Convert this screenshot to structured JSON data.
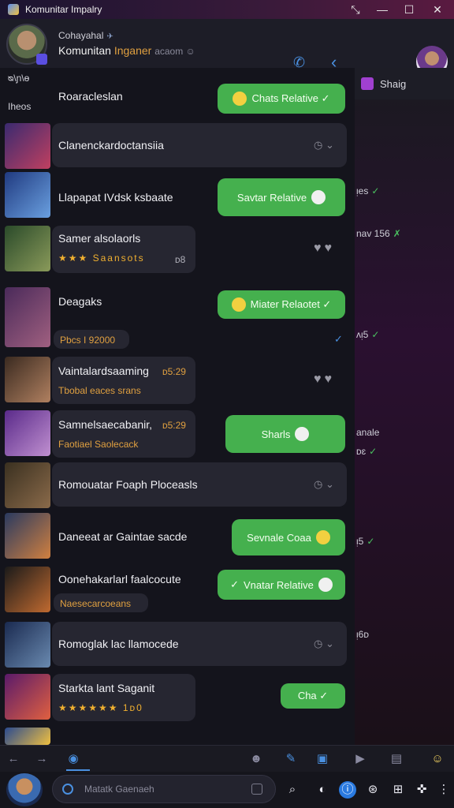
{
  "window": {
    "title": "Komunitar Impalry",
    "controls": [
      "✕̶",
      "—",
      "☐",
      "✕"
    ]
  },
  "header": {
    "name": "Cohayahal",
    "subtitle_main": "Komunitan",
    "subtitle_accent": "Inganer",
    "subtitle_muted": "acaom ☺"
  },
  "left_labels": {
    "top": "ᴓ\\ɲ\\ɵ",
    "second": "Iheos"
  },
  "right_panel": {
    "title": "Shaig",
    "items": [
      {
        "text": "ᴉes",
        "mark": "✓"
      },
      {
        "text": "nav 156",
        "mark": "✗"
      },
      {
        "text": "ᴧᴉ5",
        "mark": "✓"
      },
      {
        "text": "anale",
        "mark": ""
      },
      {
        "text": "ᴅɛ",
        "mark": "✓"
      },
      {
        "text": "ᴉ5",
        "mark": "✓"
      },
      {
        "text": "ᴉ6ᴅ",
        "mark": ""
      }
    ]
  },
  "messages": [
    {
      "title": "Roaracleslan",
      "sub": "",
      "action": "Chats Relative ✓"
    },
    {
      "title": "Clanenckardoctansiia",
      "sub": "",
      "action": ""
    },
    {
      "title": "Llapapat IVdsk ksbaate",
      "sub": "",
      "action": "Savtar Relative"
    },
    {
      "title": "Samer alsolaorls",
      "sub": "★★★ Saansots",
      "action": ""
    },
    {
      "title": "Deagaks",
      "sub": "Pbcs I 92000",
      "action": "Miater Relaotet ✓"
    },
    {
      "title": "Vaintalardsaaming",
      "sub": "Tbobal eaces srans",
      "action": ""
    },
    {
      "title": "Samnelsaecabanir,",
      "sub": "Faotiael Saolecack",
      "action": "Sharls"
    },
    {
      "title": "Romouatar Foaph Ploceasls",
      "sub": "",
      "action": ""
    },
    {
      "title": "Daneeat ar Gaintae sacde",
      "sub": "",
      "action": "Sevnale Coaa"
    },
    {
      "title": "Oonehakarlarl faalcocute",
      "sub": "Naesecarcoeans",
      "action": "Vnatar Relative"
    },
    {
      "title": "Romoglak lac llamocede",
      "sub": "",
      "action": ""
    },
    {
      "title": "Starkta lant Saganit",
      "sub": "★★★★★★ 1ᴅ0",
      "action": "Cha ✓"
    }
  ],
  "meta_small": {
    "r4_time": "ᴅ8",
    "r6_time": "ᴅ5:29",
    "r7_time": "ᴅ5:29"
  },
  "composer": {
    "placeholder": "Matatk Gaenaeh"
  },
  "colors": {
    "accent_green": "#45b04e",
    "accent_blue": "#4a90e0",
    "accent_orange": "#e0a040",
    "background": "#14141c"
  }
}
